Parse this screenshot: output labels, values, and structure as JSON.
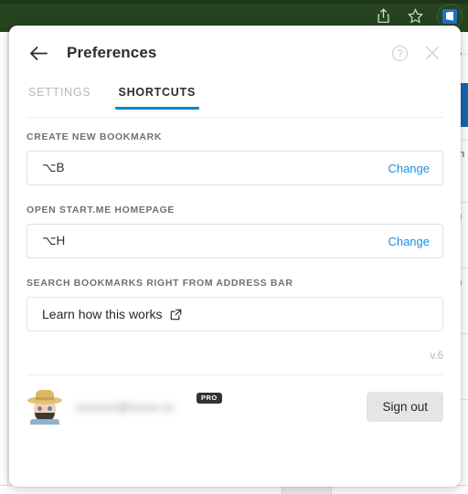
{
  "browser": {
    "share_icon": "share-icon",
    "bookmark_icon": "star-icon",
    "extension_icon": "startme-extension-icon",
    "topbar_color": "#26441f"
  },
  "panel": {
    "title": "Preferences",
    "back_icon": "back-arrow-icon",
    "help_icon": "help-circle-icon",
    "close_icon": "close-icon",
    "accent_color": "#0d85cd",
    "link_color": "#1a8fe0"
  },
  "tabs": [
    {
      "label": "SETTINGS",
      "active": false
    },
    {
      "label": "SHORTCUTS",
      "active": true
    }
  ],
  "shortcuts": [
    {
      "label": "CREATE NEW BOOKMARK",
      "value": "⌥B",
      "action_label": "Change"
    },
    {
      "label": "OPEN START.ME HOMEPAGE",
      "value": "⌥H",
      "action_label": "Change"
    }
  ],
  "address_bar_section": {
    "label": "SEARCH BOOKMARKS RIGHT FROM ADDRESS BAR",
    "link_text": "Learn how this works",
    "link_icon": "external-link-icon"
  },
  "version": "v.6",
  "footer": {
    "avatar": "user-avatar",
    "email": "xxxxxxx@xxxxx.xx",
    "pro_badge": "PRO",
    "sign_out_label": "Sign out"
  }
}
